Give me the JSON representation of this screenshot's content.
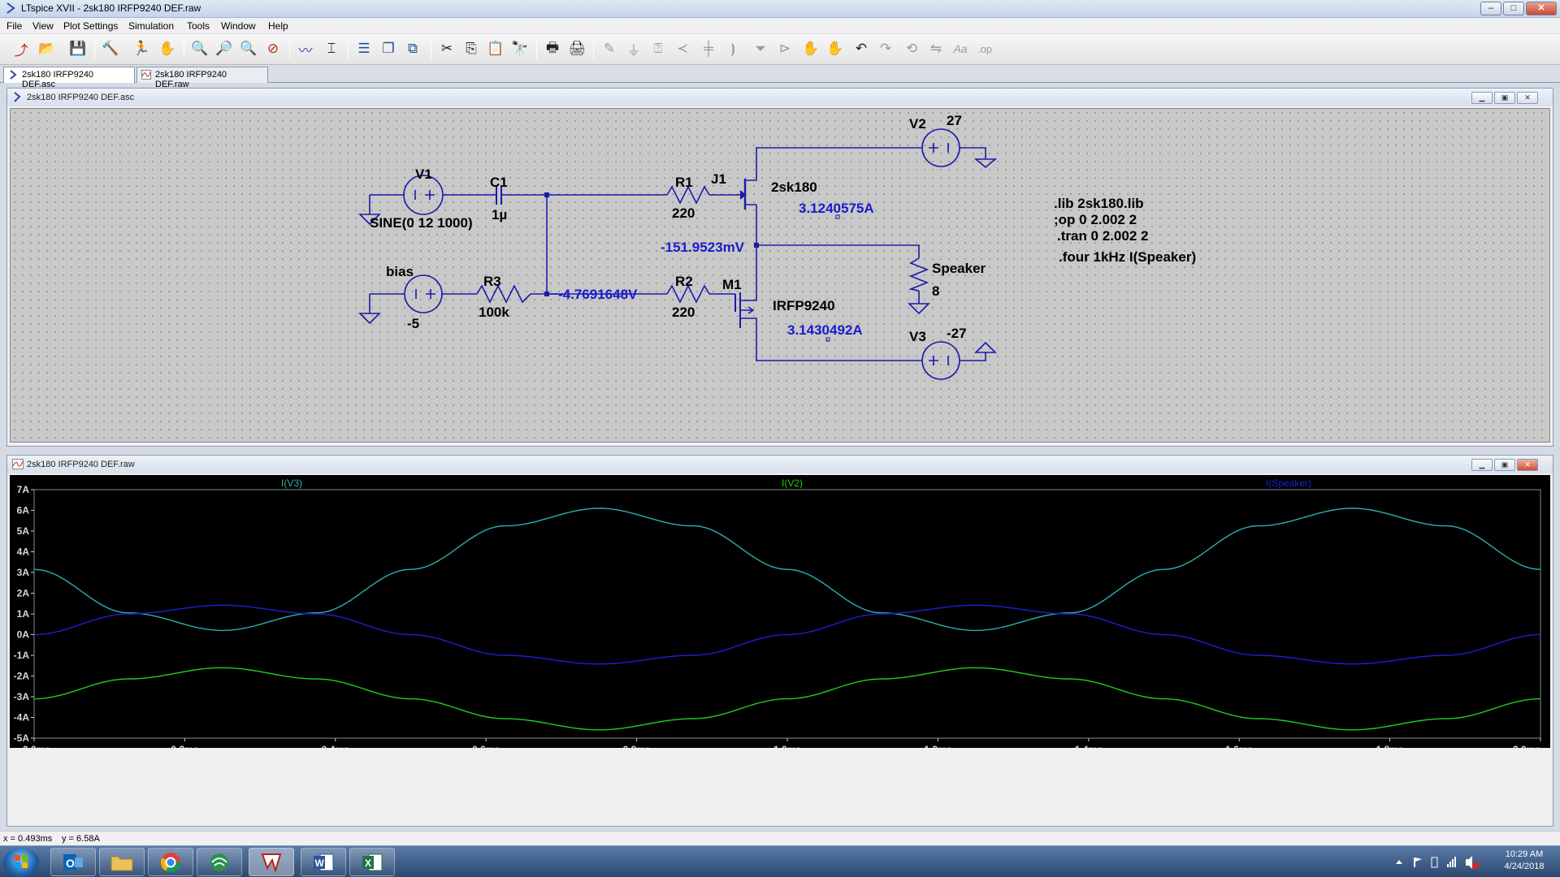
{
  "window": {
    "title": "LTspice XVII - 2sk180 IRFP9240 DEF.raw",
    "minimize": "–",
    "maximize": "□",
    "close": "✕"
  },
  "menu": [
    "File",
    "View",
    "Plot Settings",
    "Simulation",
    "Tools",
    "Window",
    "Help"
  ],
  "toolbar": [
    "open-new-schematic-icon",
    "open-file-icon",
    "save-icon",
    "control-panel-icon",
    "run-icon",
    "pan-hand-icon",
    "zoom-in-icon",
    "zoom-box-icon",
    "zoom-out-icon",
    "zoom-cancel-icon",
    "autorange-icon",
    "cursor-icon",
    "tile-horizontal-icon",
    "cascade-icon",
    "close-all-icon",
    "cut-icon",
    "copy-icon",
    "paste-icon",
    "find-icon",
    "print-setup-icon",
    "print-icon",
    "draw-wire-icon",
    "ground-icon",
    "label-net-icon",
    "resistor-icon",
    "capacitor-icon",
    "inductor-icon",
    "diode-icon",
    "component-icon",
    "move-icon",
    "drag-icon",
    "undo-icon",
    "redo-icon",
    "rotate-icon",
    "mirror-icon",
    "text-icon",
    "spice-directive-icon"
  ],
  "tabs": [
    {
      "label": "2sk180 IRFP9240 DEF.asc"
    },
    {
      "label": "2sk180 IRFP9240 DEF.raw"
    }
  ],
  "schematic": {
    "title": "2sk180 IRFP9240 DEF.asc",
    "components": {
      "V1": {
        "name": "V1",
        "value": "SINE(0 12 1000)"
      },
      "C1": {
        "name": "C1",
        "value": "1µ"
      },
      "R1": {
        "name": "R1",
        "value": "220"
      },
      "J1": {
        "name": "J1",
        "value": "2sk180"
      },
      "V2": {
        "name": "V2",
        "value": "27"
      },
      "bias": {
        "name": "bias",
        "value": "-5"
      },
      "R3": {
        "name": "R3",
        "value": "100k"
      },
      "R2": {
        "name": "R2",
        "value": "220"
      },
      "M1": {
        "name": "M1",
        "value": "IRFP9240"
      },
      "V3": {
        "name": "V3",
        "value": "-27"
      },
      "Speaker": {
        "name": "Speaker",
        "value": "8"
      }
    },
    "annotations": {
      "j1_current": "3.1240575A",
      "m1_current": "3.1430492A",
      "output_voltage": "-151.9523mV",
      "bias_voltage": "-4.7691648V"
    },
    "directives": [
      ".lib 2sk180.lib",
      ";op 0 2.002 2",
      ".tran 0 2.002 2",
      ".four 1kHz I(Speaker)"
    ]
  },
  "plot": {
    "title": "2sk180 IRFP9240 DEF.raw",
    "cursor_readout": {
      "x": "x = 0.493ms",
      "y": "y = 6.58A"
    }
  },
  "chart_data": {
    "type": "line",
    "xlim": [
      0,
      2.0
    ],
    "ylim": [
      -5,
      7
    ],
    "x_ticks": [
      "0.0ms",
      "0.2ms",
      "0.4ms",
      "0.6ms",
      "0.8ms",
      "1.0ms",
      "1.2ms",
      "1.4ms",
      "1.6ms",
      "1.8ms",
      "2.0ms"
    ],
    "y_ticks": [
      "7A",
      "6A",
      "5A",
      "4A",
      "3A",
      "2A",
      "1A",
      "0A",
      "-1A",
      "-2A",
      "-3A",
      "-4A",
      "-5A"
    ],
    "grid": false,
    "series": [
      {
        "name": "I(V3)",
        "color": "#2ab0b0",
        "x": [
          0,
          0.125,
          0.25,
          0.375,
          0.5,
          0.625,
          0.75,
          0.875,
          1.0,
          1.125,
          1.25,
          1.375,
          1.5,
          1.625,
          1.75,
          1.875,
          2.0
        ],
        "y": [
          3.15,
          1.05,
          0.2,
          1.05,
          3.15,
          5.25,
          6.1,
          5.25,
          3.15,
          1.05,
          0.2,
          1.05,
          3.15,
          5.25,
          6.1,
          5.25,
          3.15
        ]
      },
      {
        "name": "I(V2)",
        "color": "#22cc22",
        "x": [
          0,
          0.125,
          0.25,
          0.375,
          0.5,
          0.625,
          0.75,
          0.875,
          1.0,
          1.125,
          1.25,
          1.375,
          1.5,
          1.625,
          1.75,
          1.875,
          2.0
        ],
        "y": [
          -3.1,
          -2.14,
          -1.6,
          -2.14,
          -3.1,
          -4.06,
          -4.6,
          -4.06,
          -3.1,
          -2.14,
          -1.6,
          -2.14,
          -3.1,
          -4.06,
          -4.6,
          -4.06,
          -3.1
        ]
      },
      {
        "name": "I(Speaker)",
        "color": "#1f1fd6",
        "x": [
          0,
          0.125,
          0.25,
          0.375,
          0.5,
          0.625,
          0.75,
          0.875,
          1.0,
          1.125,
          1.25,
          1.375,
          1.5,
          1.625,
          1.75,
          1.875,
          2.0
        ],
        "y": [
          0.0,
          1.0,
          1.42,
          1.0,
          0.0,
          -1.0,
          -1.42,
          -1.0,
          0.0,
          1.0,
          1.42,
          1.0,
          0.0,
          -1.0,
          -1.42,
          -1.0,
          0.0
        ]
      }
    ]
  },
  "taskbar": {
    "apps": [
      "outlook-icon",
      "file-explorer-icon",
      "chrome-icon",
      "network-app-icon",
      "ltspice-icon",
      "word-icon",
      "excel-icon"
    ],
    "time": "10:29 AM",
    "date": "4/24/2018"
  }
}
